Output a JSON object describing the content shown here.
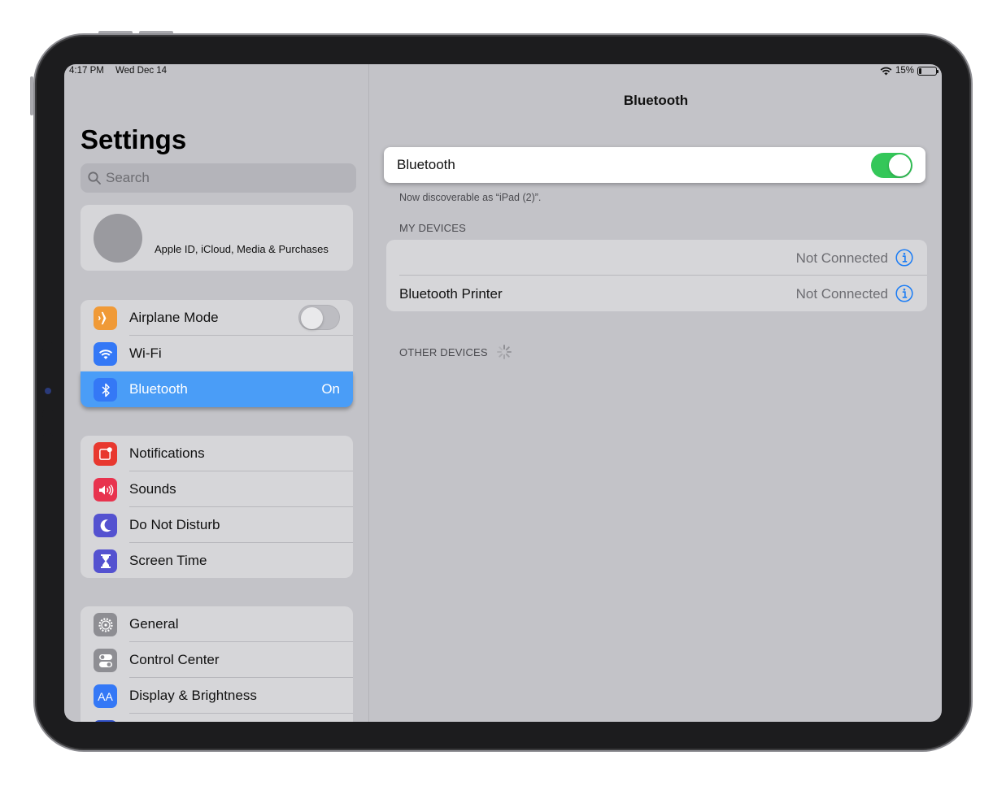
{
  "status_bar": {
    "time": "4:17 PM",
    "date": "Wed Dec 14",
    "battery": "15%",
    "battery_level": 0.15
  },
  "sidebar": {
    "title": "Settings",
    "search_placeholder": "Search",
    "profile_label": "Apple ID, iCloud, Media & Purchases",
    "group1": [
      {
        "label": "Airplane Mode",
        "icon": "airplane-icon",
        "color": "#f09a37",
        "toggle": false
      },
      {
        "label": "Wi-Fi",
        "icon": "wifi-icon",
        "color": "#3478f6"
      },
      {
        "label": "Bluetooth",
        "icon": "bluetooth-icon",
        "color": "#3478f6",
        "value": "On",
        "selected": true
      }
    ],
    "group2": [
      {
        "label": "Notifications",
        "icon": "notifications-icon",
        "color": "#eb4d3d"
      },
      {
        "label": "Sounds",
        "icon": "sounds-icon",
        "color": "#eb445a"
      },
      {
        "label": "Do Not Disturb",
        "icon": "moon-icon",
        "color": "#5856d6"
      },
      {
        "label": "Screen Time",
        "icon": "hourglass-icon",
        "color": "#5856d6"
      }
    ],
    "group3": [
      {
        "label": "General",
        "icon": "gear-icon",
        "color": "#8e8e93"
      },
      {
        "label": "Control Center",
        "icon": "switches-icon",
        "color": "#8e8e93"
      },
      {
        "label": "Display & Brightness",
        "icon": "text-size-icon",
        "color": "#3478f6",
        "icon_text": "AA"
      }
    ]
  },
  "detail": {
    "title": "Bluetooth",
    "toggle_label": "Bluetooth",
    "toggle_on": true,
    "discoverable": "Now discoverable as “iPad (2)”.",
    "my_devices_header": "MY DEVICES",
    "devices": [
      {
        "name": "",
        "status": "Not Connected"
      },
      {
        "name": "Bluetooth Printer",
        "status": "Not Connected"
      }
    ],
    "other_devices_header": "OTHER DEVICES"
  },
  "colors": {
    "accent": "#4a9df7",
    "toggle_on": "#34c759",
    "info_blue": "#1a7cf5"
  }
}
